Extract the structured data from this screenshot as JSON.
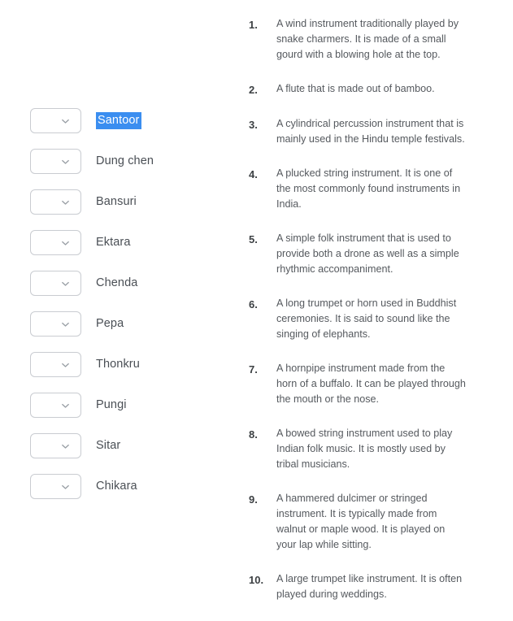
{
  "quiz": {
    "answer_options": [
      {
        "label": "Santoor",
        "selected": true,
        "dropdown_value": ""
      },
      {
        "label": "Dung chen",
        "selected": false,
        "dropdown_value": ""
      },
      {
        "label": "Bansuri",
        "selected": false,
        "dropdown_value": ""
      },
      {
        "label": "Ektara",
        "selected": false,
        "dropdown_value": ""
      },
      {
        "label": "Chenda",
        "selected": false,
        "dropdown_value": ""
      },
      {
        "label": "Pepa",
        "selected": false,
        "dropdown_value": ""
      },
      {
        "label": "Thonkru",
        "selected": false,
        "dropdown_value": ""
      },
      {
        "label": "Pungi",
        "selected": false,
        "dropdown_value": ""
      },
      {
        "label": "Sitar",
        "selected": false,
        "dropdown_value": ""
      },
      {
        "label": "Chikara",
        "selected": false,
        "dropdown_value": ""
      }
    ],
    "clues": [
      {
        "number": "1.",
        "text": "A wind instrument traditionally played by snake charmers.  It is made of a small gourd with a blowing hole at the top."
      },
      {
        "number": "2.",
        "text": "A flute that is made out of bamboo."
      },
      {
        "number": "3.",
        "text": "A cylindrical percussion instrument that is mainly used in the Hindu temple festivals."
      },
      {
        "number": "4.",
        "text": "A plucked string instrument.  It is one of the most commonly found instruments in India."
      },
      {
        "number": "5.",
        "text": "A simple folk instrument that is used to provide both a drone as well as a simple rhythmic accompaniment."
      },
      {
        "number": "6.",
        "text": "A long trumpet or horn used in Buddhist ceremonies.  It is said to sound like the singing of elephants."
      },
      {
        "number": "7.",
        "text": "A hornpipe instrument made from the horn of a buffalo.  It can be played through the mouth or the nose."
      },
      {
        "number": "8.",
        "text": "A bowed string instrument used to play Indian folk music.  It is mostly used by tribal musicians."
      },
      {
        "number": "9.",
        "text": "A hammered dulcimer or stringed instrument.  It is typically made from walnut or maple wood.  It is played on your lap while sitting."
      },
      {
        "number": "10.",
        "text": "A large trumpet like instrument.  It is often played during weddings."
      }
    ],
    "colors": {
      "selection_highlight": "#3b8ef0",
      "selection_text": "#ffffff",
      "border": "#c9ccd1",
      "body_text": "#55595e",
      "label_text": "#4a4f55"
    }
  }
}
